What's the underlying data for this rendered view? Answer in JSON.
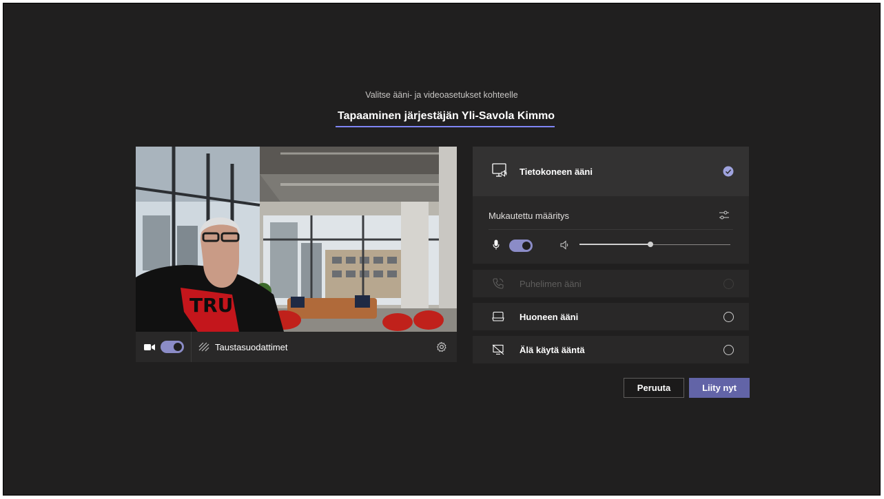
{
  "header": {
    "subtitle": "Valitse ääni- ja videoasetukset kohteelle",
    "meeting_title": "Tapaaminen järjestäjän Yli-Savola Kimmo"
  },
  "video": {
    "camera_on": true,
    "background_filters_label": "Taustasuodattimet",
    "shirt_text": "TRU"
  },
  "audio": {
    "computer_audio_label": "Tietokoneen ääni",
    "computer_audio_selected": true,
    "custom_setup_label": "Mukautettu määritys",
    "mic_on": true,
    "speaker_volume": 0.47,
    "phone_audio_label": "Puhelimen ääni",
    "room_audio_label": "Huoneen ääni",
    "no_audio_label": "Älä käytä ääntä"
  },
  "buttons": {
    "cancel_label": "Peruuta",
    "join_label": "Liity nyt"
  },
  "colors": {
    "accent": "#6264a7",
    "toggle": "#8b8cc7",
    "background": "#201f1f"
  }
}
